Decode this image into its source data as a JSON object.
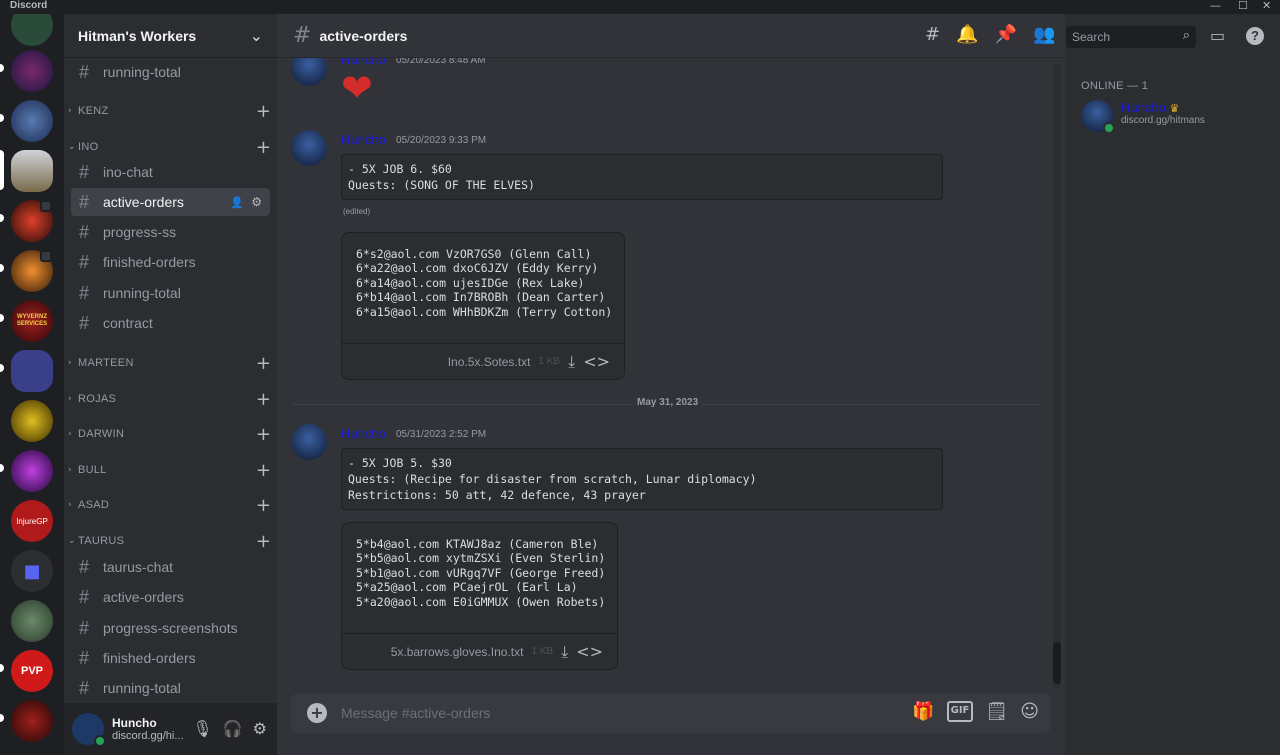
{
  "window": {
    "brand": "Discord",
    "minimize": "—",
    "maximize": "☐",
    "close": "✕"
  },
  "server": {
    "name": "Hitman's Workers",
    "chevron": "⌄"
  },
  "channels": [
    {
      "type": "channel",
      "name": "running-total"
    },
    {
      "type": "category",
      "name": "KENZ"
    },
    {
      "type": "category",
      "name": "INO",
      "open": true
    },
    {
      "type": "channel",
      "name": "ino-chat"
    },
    {
      "type": "channel",
      "name": "active-orders",
      "active": true
    },
    {
      "type": "channel",
      "name": "progress-ss"
    },
    {
      "type": "channel",
      "name": "finished-orders"
    },
    {
      "type": "channel",
      "name": "running-total"
    },
    {
      "type": "channel",
      "name": "contract"
    },
    {
      "type": "category",
      "name": "MARTEEN"
    },
    {
      "type": "category",
      "name": "ROJAS"
    },
    {
      "type": "category",
      "name": "DARWIN"
    },
    {
      "type": "category",
      "name": "BULL"
    },
    {
      "type": "category",
      "name": "ASAD"
    },
    {
      "type": "category",
      "name": "TAURUS",
      "open": true
    },
    {
      "type": "channel",
      "name": "taurus-chat"
    },
    {
      "type": "channel",
      "name": "active-orders"
    },
    {
      "type": "channel",
      "name": "progress-screenshots"
    },
    {
      "type": "channel",
      "name": "finished-orders"
    },
    {
      "type": "channel",
      "name": "running-total"
    }
  ],
  "user": {
    "name": "Huncho",
    "status": "discord.gg/hi..."
  },
  "channel_header": {
    "name": "active-orders"
  },
  "search": {
    "placeholder": "Search"
  },
  "messages": [
    {
      "author": "Huncho",
      "time": "05/20/2023 8:48 AM",
      "content": "❤"
    },
    {
      "author": "Huncho",
      "time": "05/20/2023 9:33 PM",
      "code": "- 5X JOB 6. $60\nQuests: (SONG OF THE ELVES)",
      "edited": "(edited)",
      "attachment": {
        "text": "6*s2@aol.com VzOR7GS0 (Glenn Call)\n6*a22@aol.com dxoC6JZV (Eddy Kerry)\n6*a14@aol.com ujesIDGe (Rex Lake)\n6*b14@aol.com In7BROBh (Dean Carter)\n6*a15@aol.com WHhBDKZm (Terry Cotton)",
        "filename": "Ino.5x.Sotes.txt",
        "size": "1 KB"
      }
    },
    {
      "divider": "May 31, 2023"
    },
    {
      "author": "Huncho",
      "time": "05/31/2023 2:52 PM",
      "code": "- 5X JOB 5. $30\nQuests: (Recipe for disaster from scratch, Lunar diplomacy)\nRestrictions: 50 att, 42 defence, 43 prayer",
      "attachment": {
        "text": "5*b4@aol.com KTAWJ8az (Cameron Ble)\n5*b5@aol.com xytmZSXi (Even Sterlin)\n5*b1@aol.com vURgq7VF (George Freed)\n5*a25@aol.com PCaejrOL (Earl La)\n5*a20@aol.com E0iGMMUX (Owen Robets)",
        "filename": "5x.barrows.gloves.Ino.txt",
        "size": "1 KB"
      }
    }
  ],
  "composer": {
    "placeholder": "Message #active-orders",
    "gif": "GIF"
  },
  "members": {
    "header": "ONLINE — 1",
    "list": [
      {
        "name": "Huncho",
        "crown": "♛",
        "status": "discord.gg/hitmans"
      }
    ]
  },
  "guild_labels": {
    "injure": "InjureGP",
    "pvp": "PVP",
    "wyvern": "WYVERNZ SERVICES"
  },
  "colors": {
    "accent": "#5865f2",
    "online": "#23a55a",
    "author": "#1a1adb",
    "heart": "#d42b2b"
  }
}
